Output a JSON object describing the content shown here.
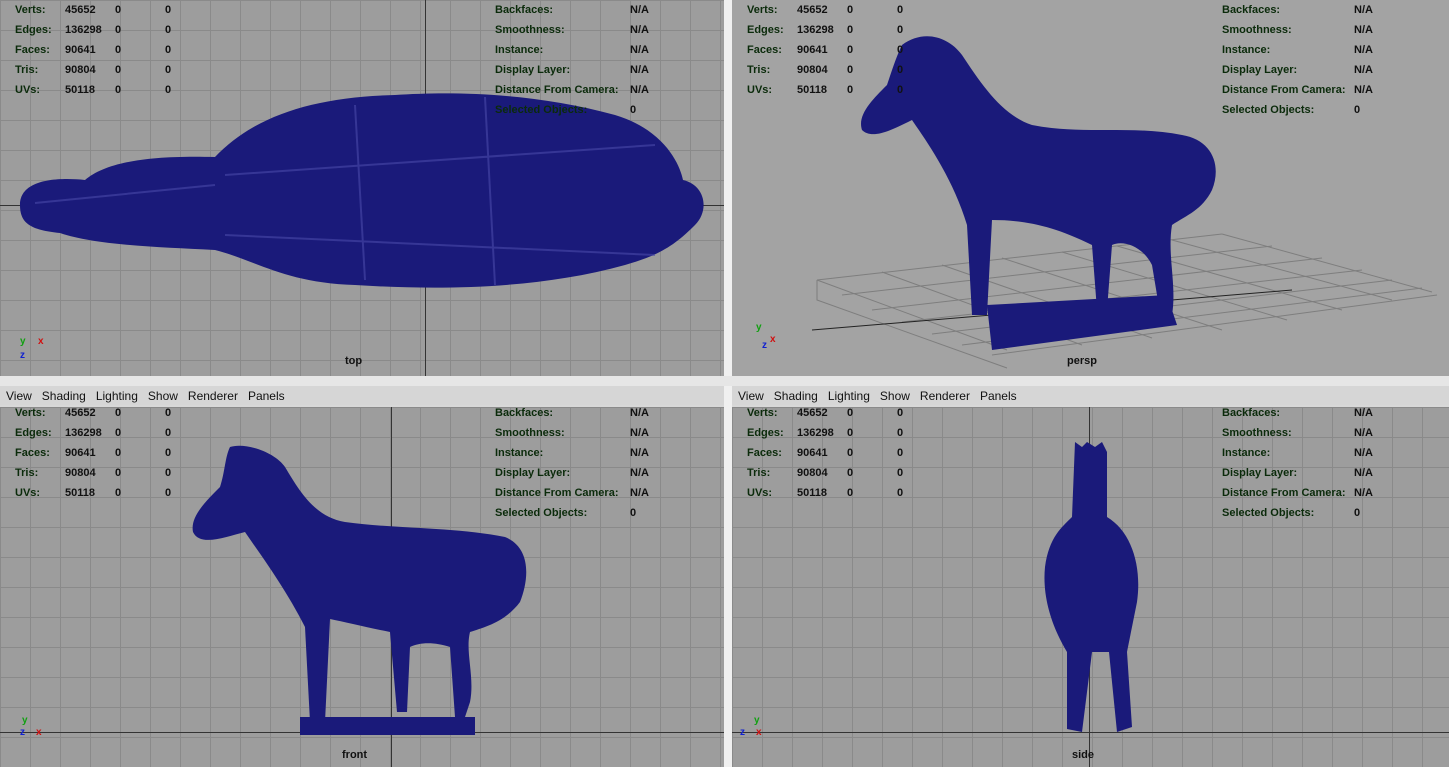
{
  "menu": [
    "View",
    "Shading",
    "Lighting",
    "Show",
    "Renderer",
    "Panels"
  ],
  "hud_left": [
    {
      "label": "Verts:",
      "v1": "45652",
      "v2": "0",
      "v3": "0"
    },
    {
      "label": "Edges:",
      "v1": "136298",
      "v2": "0",
      "v3": "0"
    },
    {
      "label": "Faces:",
      "v1": "90641",
      "v2": "0",
      "v3": "0"
    },
    {
      "label": "Tris:",
      "v1": "90804",
      "v2": "0",
      "v3": "0"
    },
    {
      "label": "UVs:",
      "v1": "50118",
      "v2": "0",
      "v3": "0"
    }
  ],
  "hud_right": [
    {
      "label": "Backfaces:",
      "value": "N/A"
    },
    {
      "label": "Smoothness:",
      "value": "N/A"
    },
    {
      "label": "Instance:",
      "value": "N/A"
    },
    {
      "label": "Display Layer:",
      "value": "N/A"
    },
    {
      "label": "Distance From Camera:",
      "value": "N/A"
    },
    {
      "label": "Selected Objects:",
      "value": "0"
    }
  ],
  "viewports": [
    {
      "name": "top"
    },
    {
      "name": "persp"
    },
    {
      "name": "front"
    },
    {
      "name": "side"
    }
  ],
  "axes": {
    "x": "x",
    "y": "y",
    "z": "z"
  },
  "colors": {
    "mesh": "#1a1a7a",
    "viewport_bg": "#9d9d9d",
    "hud_label": "#0b2b0b"
  }
}
